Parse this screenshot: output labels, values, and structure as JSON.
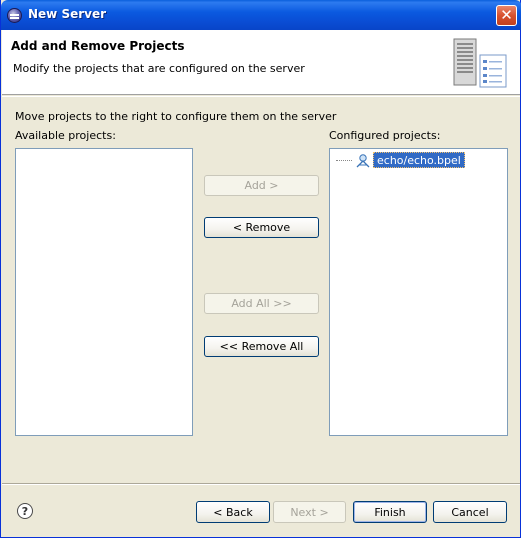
{
  "window": {
    "title": "New Server",
    "close_glyph": "✕"
  },
  "header": {
    "title": "Add and Remove Projects",
    "description": "Modify the projects that are configured on the server",
    "graphic_icon": "server-wizard-icon"
  },
  "main": {
    "instruction": "Move projects to the right to configure them on the server",
    "available_label": "Available projects:",
    "configured_label": "Configured projects:",
    "available_items": [],
    "configured_items": [
      {
        "label": "echo/echo.bpel",
        "icon": "bpel-process-icon",
        "selected": true
      }
    ]
  },
  "transfer_buttons": {
    "add": "Add >",
    "remove": "< Remove",
    "add_all": "Add All >>",
    "remove_all": "<< Remove All"
  },
  "footer": {
    "help_glyph": "?",
    "back": "< Back",
    "next": "Next >",
    "finish": "Finish",
    "cancel": "Cancel"
  },
  "colors": {
    "titlebar": "#0A4ED5",
    "selection": "#316AC5",
    "dialog_bg": "#ECE9D8"
  }
}
